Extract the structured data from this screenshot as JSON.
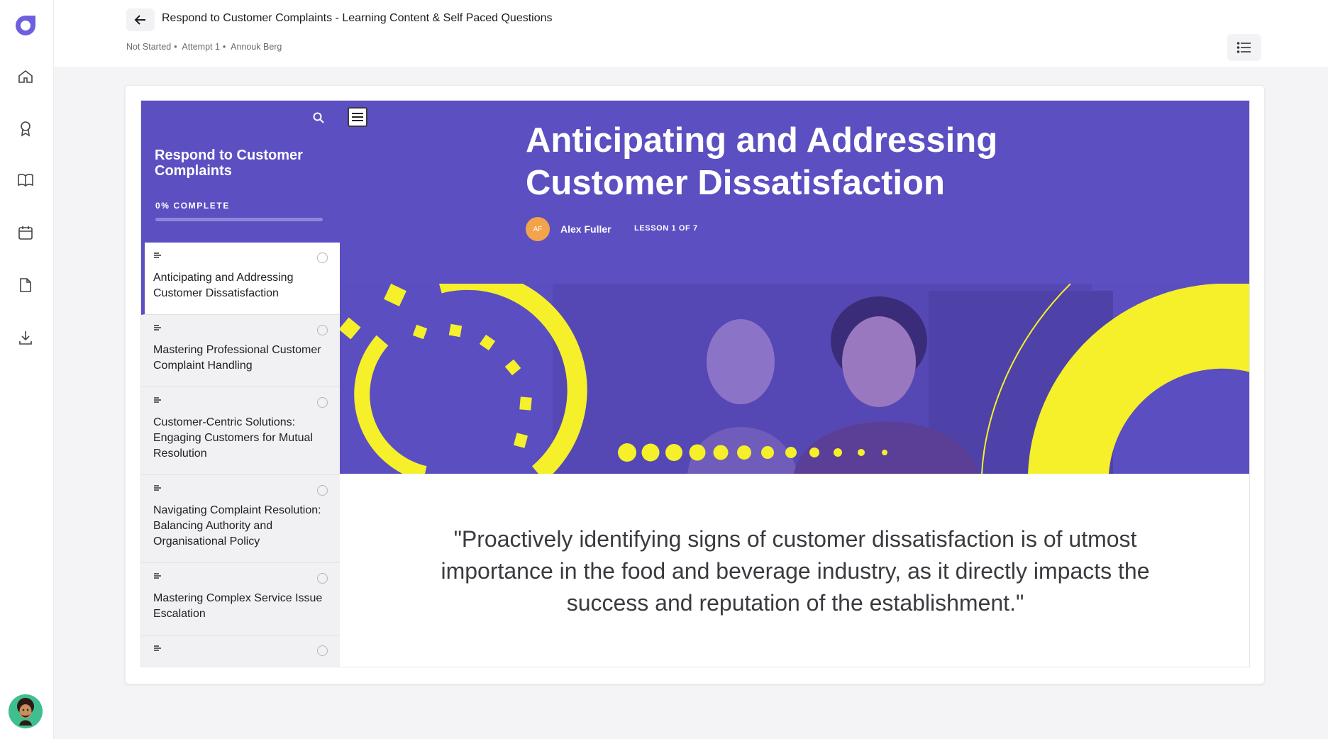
{
  "header": {
    "title": "Respond to Customer Complaints - Learning Content & Self Paced Questions",
    "status": "Not Started",
    "attempt": "Attempt 1",
    "learner": "Annouk Berg",
    "sep": "•"
  },
  "rail": {
    "items": [
      "home-icon",
      "award-icon",
      "book-icon",
      "calendar-icon",
      "document-icon",
      "download-icon"
    ]
  },
  "course": {
    "title": "Respond to Customer Complaints",
    "progress_label": "0% COMPLETE",
    "progress_fraction": 0,
    "lessons": [
      {
        "name": "Anticipating and Addressing Customer Dissatisfaction",
        "active": true
      },
      {
        "name": "Mastering Professional Customer Complaint Handling",
        "active": false
      },
      {
        "name": "Customer-Centric Solutions: Engaging Customers for Mutual Resolution",
        "active": false
      },
      {
        "name": "Navigating Complaint Resolution: Balancing Authority and Organisational Policy",
        "active": false
      },
      {
        "name": "Mastering Complex Service Issue Escalation",
        "active": false
      },
      {
        "name": "",
        "active": false
      }
    ]
  },
  "lesson": {
    "title": "Anticipating and Addressing Customer Dissatisfaction",
    "author_initials": "AF",
    "author": "Alex Fuller",
    "count": "LESSON 1 OF 7",
    "quote": "\"Proactively identifying signs of customer dissatisfaction is of utmost importance in the food and beverage industry, as it directly impacts the success and reputation of the establishment.\""
  },
  "colors": {
    "brand": "#5b4fc2",
    "accent_yellow": "#f5f02a"
  }
}
